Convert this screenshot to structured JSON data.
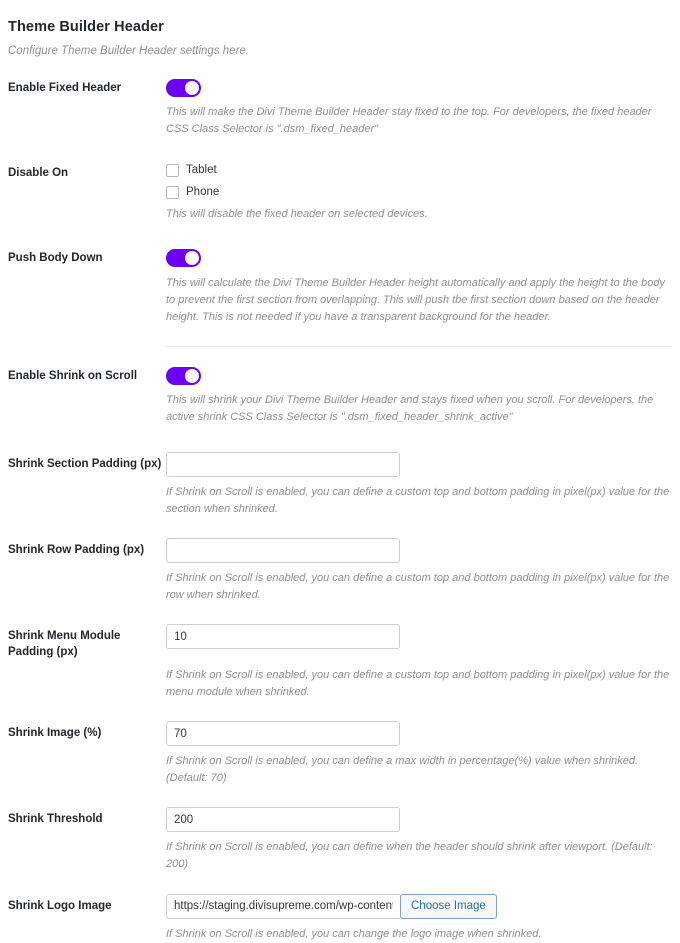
{
  "panel": {
    "title": "Theme Builder Header",
    "subtitle": "Configure Theme Builder Header settings here."
  },
  "accent_color": "#6c00f6",
  "link_color": "#2271b1",
  "fields": {
    "enable_fixed_header": {
      "label": "Enable Fixed Header",
      "toggle_state": "on",
      "description": "This will make the Divi Theme Builder Header stay fixed to the top. For developers, the fixed header CSS Class Selector is \".dsm_fixed_header\""
    },
    "disable_on": {
      "label": "Disable On",
      "options": [
        {
          "label": "Tablet",
          "checked": false
        },
        {
          "label": "Phone",
          "checked": false
        }
      ],
      "description": "This will disable the fixed header on selected devices."
    },
    "push_body_down": {
      "label": "Push Body Down",
      "toggle_state": "on",
      "description": "This will calculate the Divi Theme Builder Header height automatically and apply the height to the body to prevent the first section from overlapping. This will push tbe first section down based on the header height. This is not needed if you have a transparent background for the header."
    },
    "enable_shrink_on_scroll": {
      "label": "Enable Shrink on Scroll",
      "toggle_state": "on",
      "description": "This will shrink your Divi Theme Builder Header and stays fixed when you scroll. For developers, the active shrink CSS Class Selector is \".dsm_fixed_header_shrink_active\""
    },
    "shrink_section_padding": {
      "label": "Shrink Section Padding (px)",
      "value": "",
      "placeholder": "",
      "description": "If Shrink on Scroll is enabled, you can define a custom top and bottom padding in pixel(px) value for the section when shrinked."
    },
    "shrink_row_padding": {
      "label": "Shrink Row Padding (px)",
      "value": "",
      "placeholder": "",
      "description": "If Shrink on Scroll is enabled, you can define a custom top and bottom padding in pixel(px) value for the row when shrinked."
    },
    "shrink_menu_module_padding": {
      "label": "Shrink Menu Module Padding (px)",
      "value": "10",
      "placeholder": "",
      "description": "If Shrink on Scroll is enabled, you can define a custom top and bottom padding in pixel(px) value for the menu module when shrinked."
    },
    "shrink_image": {
      "label": "Shrink Image (%)",
      "value": "70",
      "placeholder": "",
      "description": "If Shrink on Scroll is enabled, you can define a max width in percentage(%) value when shrinked. (Default: 70)"
    },
    "shrink_threshold": {
      "label": "Shrink Threshold",
      "value": "200",
      "placeholder": "",
      "description": "If Shrink on Scroll is enabled, you can define when the header should shrink after viewport. (Default: 200)"
    },
    "shrink_logo_image": {
      "label": "Shrink Logo Image",
      "value": "https://staging.divisupreme.com/wp-content/uploads,",
      "placeholder": "",
      "button_label": "Choose Image",
      "description": "If Shrink on Scroll is enabled, you can change the logo image when shrinked."
    }
  }
}
